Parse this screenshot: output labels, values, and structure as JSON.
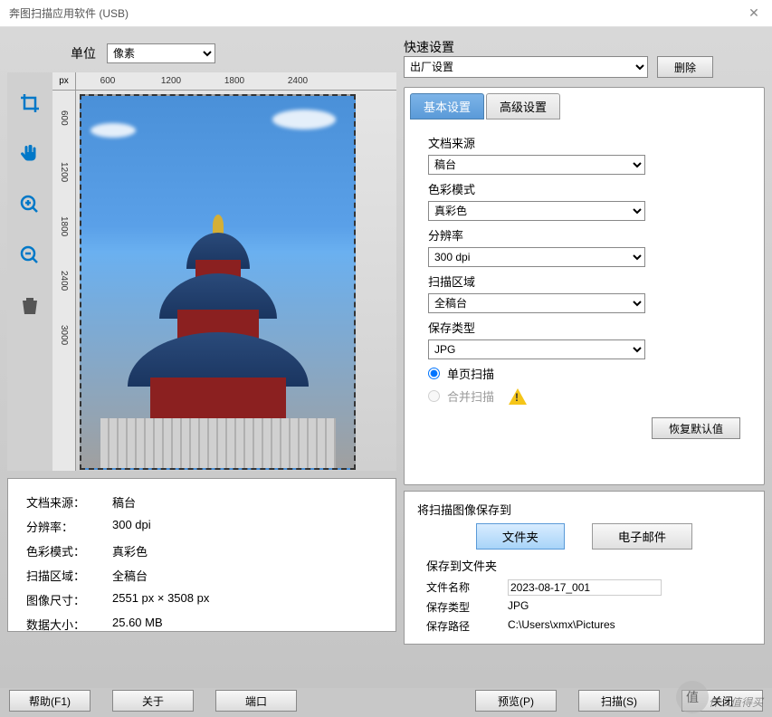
{
  "window": {
    "title": "奔图扫描应用软件 (USB)"
  },
  "unit": {
    "label": "单位",
    "value": "像素"
  },
  "ruler": {
    "corner": "px",
    "h": [
      "600",
      "1200",
      "1800",
      "2400"
    ],
    "v": [
      "600",
      "1200",
      "1800",
      "2400",
      "3000"
    ]
  },
  "quick": {
    "label": "快速设置",
    "value": "出厂设置",
    "delete": "删除"
  },
  "tabs": {
    "basic": "基本设置",
    "advanced": "高级设置"
  },
  "settings": {
    "source_label": "文档来源",
    "source_value": "稿台",
    "color_label": "色彩模式",
    "color_value": "真彩色",
    "dpi_label": "分辨率",
    "dpi_value": "300 dpi",
    "area_label": "扫描区域",
    "area_value": "全稿台",
    "save_label": "保存类型",
    "save_value": "JPG",
    "single_page": "单页扫描",
    "merge_scan": "合并扫描",
    "restore": "恢复默认值"
  },
  "info": {
    "source_l": "文档来源",
    "source_v": "稿台",
    "dpi_l": "分辨率",
    "dpi_v": "300 dpi",
    "color_l": "色彩模式",
    "color_v": "真彩色",
    "area_l": "扫描区域",
    "area_v": "全稿台",
    "size_l": "图像尺寸",
    "size_v": "2551 px × 3508 px",
    "data_l": "数据大小",
    "data_v": "25.60 MB"
  },
  "save": {
    "title": "将扫描图像保存到",
    "folder_btn": "文件夹",
    "email_btn": "电子邮件",
    "subtitle": "保存到文件夹",
    "name_l": "文件名称",
    "name_v": "2023-08-17_001",
    "type_l": "保存类型",
    "type_v": "JPG",
    "path_l": "保存路径",
    "path_v": "C:\\Users\\xmx\\Pictures"
  },
  "buttons": {
    "help": "帮助(F1)",
    "about": "关于",
    "port": "端口",
    "preview": "预览(P)",
    "scan": "扫描(S)",
    "close": "关闭"
  },
  "watermark": "什么值得买"
}
